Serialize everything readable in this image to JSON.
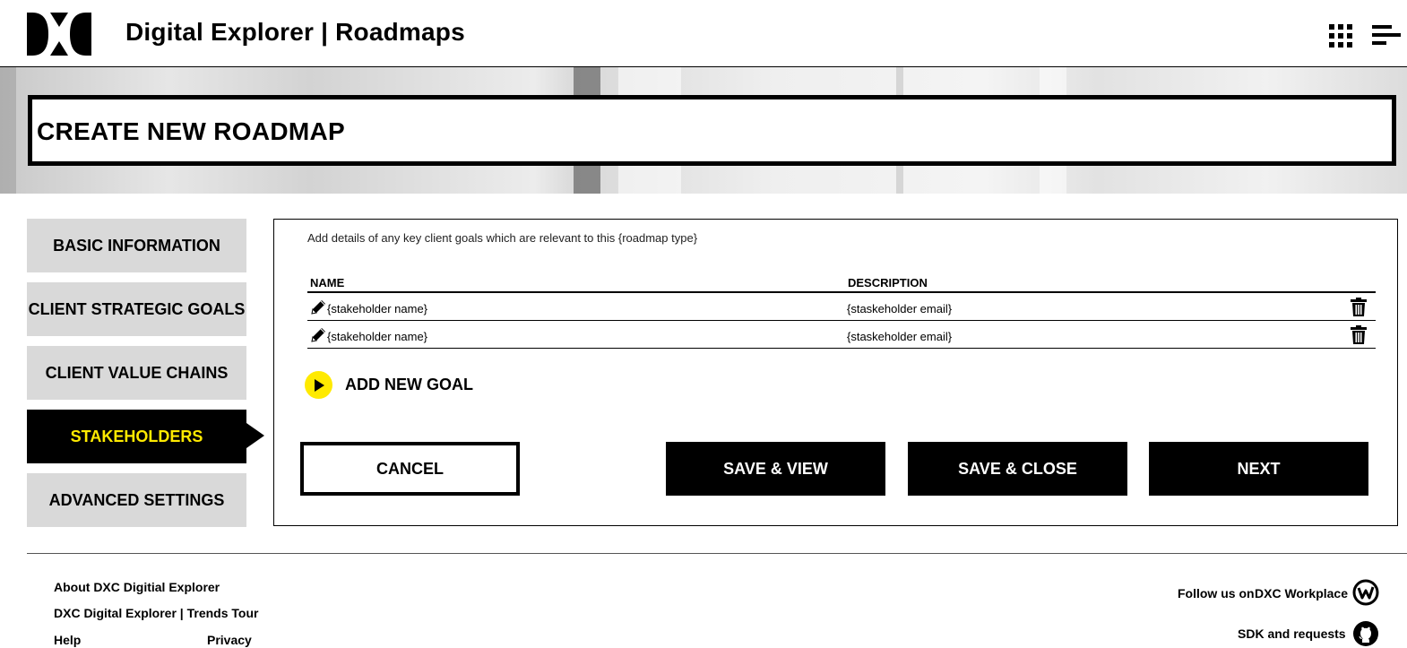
{
  "header": {
    "app_title": "Digital Explorer | Roadmaps",
    "logo_icon": "dxc-logo-icon",
    "apps_icon": "grid-apps-icon",
    "menu_icon": "hamburger-menu-icon"
  },
  "page": {
    "title": "CREATE NEW ROADMAP"
  },
  "sidebar": {
    "items": [
      {
        "label": "BASIC INFORMATION",
        "active": false
      },
      {
        "label": "CLIENT STRATEGIC GOALS",
        "active": false
      },
      {
        "label": "CLIENT VALUE CHAINS",
        "active": false
      },
      {
        "label": "STAKEHOLDERS",
        "active": true
      },
      {
        "label": "ADVANCED SETTINGS",
        "active": false
      }
    ]
  },
  "panel": {
    "hint": "Add details of any key client goals which are relevant to this {roadmap type}",
    "columns": {
      "name": "NAME",
      "description": "DESCRIPTION"
    },
    "rows": [
      {
        "name": "{stakeholder name}",
        "description": "{staskeholder email}"
      },
      {
        "name": "{stakeholder name}",
        "description": "{staskeholder email}"
      }
    ],
    "add_goal_label": "ADD NEW GOAL",
    "buttons": {
      "cancel": "CANCEL",
      "save_view": "SAVE & VIEW",
      "save_close": "SAVE & CLOSE",
      "next": "NEXT"
    }
  },
  "footer": {
    "links": {
      "about": "About DXC Digitial Explorer",
      "trends": "DXC Digital Explorer | Trends Tour",
      "help": "Help",
      "privacy": "Privacy"
    },
    "follow_label": "Follow us on",
    "workplace_label": "DXC Workplace",
    "sdk_label": "SDK and requests",
    "workplace_icon": "workplace-icon",
    "github_icon": "github-icon"
  },
  "colors": {
    "accent_yellow": "#ffea00",
    "nav_grey": "#d9d9d9",
    "black": "#000000"
  }
}
